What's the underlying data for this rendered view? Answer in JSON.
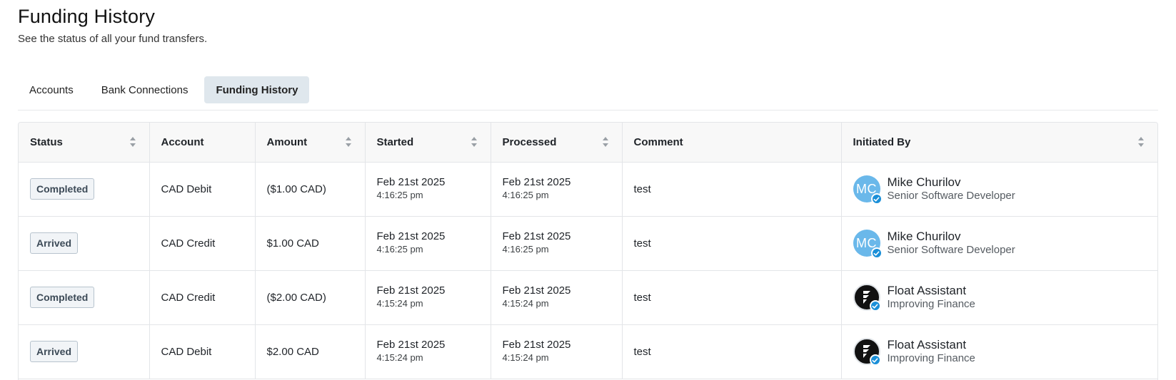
{
  "header": {
    "title": "Funding History",
    "subtitle": "See the status of all your fund transfers."
  },
  "tabs": [
    {
      "label": "Accounts",
      "active": false
    },
    {
      "label": "Bank Connections",
      "active": false
    },
    {
      "label": "Funding History",
      "active": true
    }
  ],
  "table": {
    "columns": [
      {
        "label": "Status",
        "sortable": true
      },
      {
        "label": "Account",
        "sortable": false
      },
      {
        "label": "Amount",
        "sortable": true
      },
      {
        "label": "Started",
        "sortable": true
      },
      {
        "label": "Processed",
        "sortable": true
      },
      {
        "label": "Comment",
        "sortable": false
      },
      {
        "label": "Initiated By",
        "sortable": true
      }
    ],
    "rows": [
      {
        "status": "Completed",
        "account": "CAD Debit",
        "amount": "($1.00 CAD)",
        "started_date": "Feb 21st 2025",
        "started_time": "4:16:25 pm",
        "processed_date": "Feb 21st 2025",
        "processed_time": "4:16:25 pm",
        "comment": "test",
        "initiator": {
          "avatar_type": "initials",
          "initials": "MC",
          "name": "Mike Churilov",
          "role": "Senior Software Developer"
        }
      },
      {
        "status": "Arrived",
        "account": "CAD Credit",
        "amount": "$1.00 CAD",
        "started_date": "Feb 21st 2025",
        "started_time": "4:16:25 pm",
        "processed_date": "Feb 21st 2025",
        "processed_time": "4:16:25 pm",
        "comment": "test",
        "initiator": {
          "avatar_type": "initials",
          "initials": "MC",
          "name": "Mike Churilov",
          "role": "Senior Software Developer"
        }
      },
      {
        "status": "Completed",
        "account": "CAD Credit",
        "amount": "($2.00 CAD)",
        "started_date": "Feb 21st 2025",
        "started_time": "4:15:24 pm",
        "processed_date": "Feb 21st 2025",
        "processed_time": "4:15:24 pm",
        "comment": "test",
        "initiator": {
          "avatar_type": "logo",
          "initials": "",
          "name": "Float Assistant",
          "role": "Improving Finance"
        }
      },
      {
        "status": "Arrived",
        "account": "CAD Debit",
        "amount": "$2.00 CAD",
        "started_date": "Feb 21st 2025",
        "started_time": "4:15:24 pm",
        "processed_date": "Feb 21st 2025",
        "processed_time": "4:15:24 pm",
        "comment": "test",
        "initiator": {
          "avatar_type": "logo",
          "initials": "",
          "name": "Float Assistant",
          "role": "Improving Finance"
        }
      }
    ]
  },
  "colors": {
    "active_tab_bg": "#dfe7ed",
    "avatar_initials_bg": "#6ab8ea",
    "verified_badge": "#1a8fd8",
    "logo_avatar_bg": "#111111"
  },
  "icons": {
    "sort": "sort-icon",
    "verified": "verified-check-icon",
    "float_logo": "float-logo-icon"
  }
}
